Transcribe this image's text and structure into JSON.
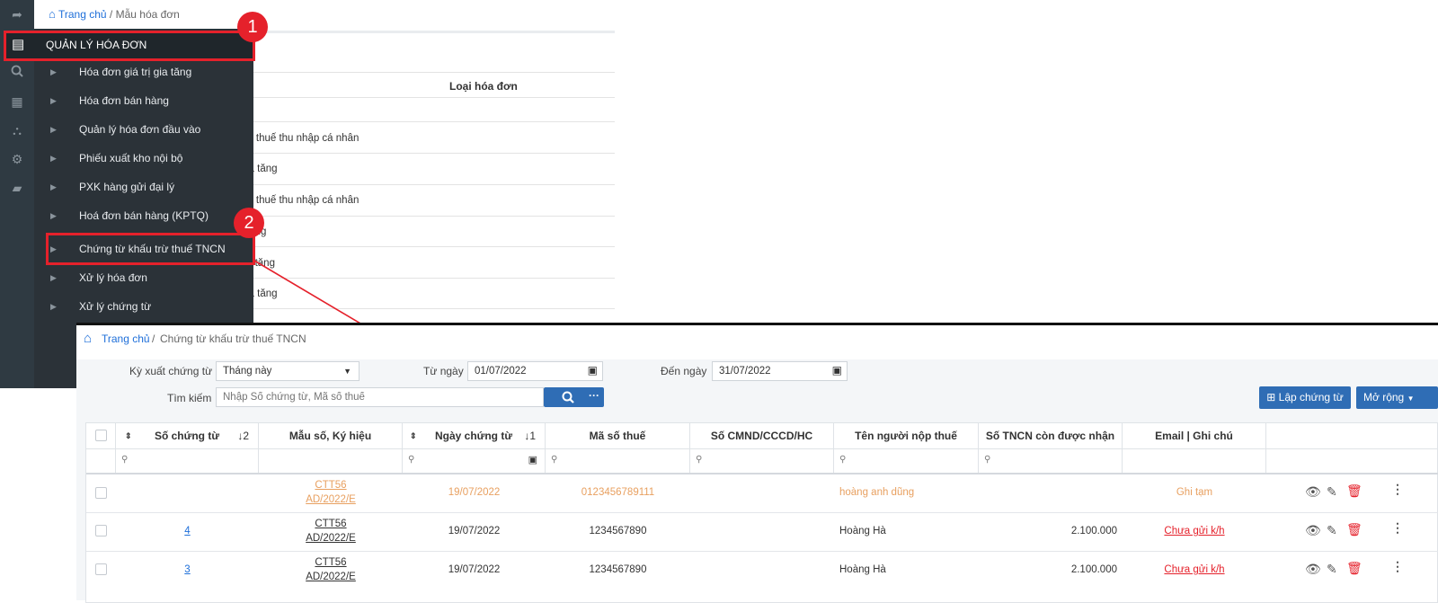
{
  "bg_page": {
    "breadcrumb_home": "Trang chủ",
    "breadcrumb_sep": "/",
    "breadcrumb_current": "Mẫu hóa đơn",
    "column_header": "Loại hóa đơn",
    "rows": [
      "ừ thuế thu nhập cá nhân",
      "ia tăng",
      "ừ thuế thu nhập cá nhân",
      "tăng",
      "a tăng",
      "ia tăng"
    ]
  },
  "menu": {
    "title": "QUẢN LÝ HÓA ĐƠN",
    "items": [
      "Hóa đơn giá trị gia tăng",
      "Hóa đơn bán hàng",
      "Quản lý hóa đơn đầu vào",
      "Phiếu xuất kho nội bộ",
      "PXK hàng gửi đại lý",
      "Hoá đơn bán hàng (KPTQ)",
      "Chứng từ khấu trừ thuế TNCN",
      "Xử lý hóa đơn",
      "Xử lý chứng từ"
    ]
  },
  "callouts": {
    "one": "1",
    "two": "2"
  },
  "colors": {
    "highlight": "#e5212b",
    "link": "#1e6fd9",
    "draft": "#e8a060",
    "unsent": "#e5212b",
    "primary": "#2f6db5"
  },
  "page": {
    "breadcrumb_home": "Trang chủ",
    "breadcrumb_sep": "/",
    "breadcrumb_current": "Chứng từ khấu trừ thuế TNCN",
    "filters": {
      "period_label": "Kỳ xuất chứng từ",
      "period_value": "Tháng này",
      "from_label": "Từ ngày",
      "from_value": "01/07/2022",
      "to_label": "Đến ngày",
      "to_value": "31/07/2022",
      "search_label": "Tìm kiếm",
      "search_placeholder": "Nhập Số chứng từ, Mã số thuế"
    },
    "buttons": {
      "create": "Lập chứng từ",
      "expand": "Mở rộng"
    },
    "table": {
      "headers": [
        "Số chứng từ",
        "Mẫu số, Ký hiệu",
        "Ngày chứng từ",
        "Mã số thuế",
        "Số CMND/CCCD/HC",
        "Tên người nộp thuế",
        "Số TNCN còn được nhận",
        "Email | Ghi chú"
      ],
      "sort_no_order": "2",
      "sort_date_order": "1",
      "rows": [
        {
          "no": "",
          "form_line1": "CTT56",
          "form_line2": "AD/2022/E",
          "date": "19/07/2022",
          "tax_code": "0123456789111",
          "id_no": "",
          "name": "hoàng anh dũng",
          "amount": "",
          "note": "Ghi tạm"
        },
        {
          "no": "4",
          "form_line1": "CTT56",
          "form_line2": "AD/2022/E",
          "date": "19/07/2022",
          "tax_code": "1234567890",
          "id_no": "",
          "name": "Hoàng Hà",
          "amount": "2.100.000",
          "note": "Chưa gửi k/h"
        },
        {
          "no": "3",
          "form_line1": "CTT56",
          "form_line2": "AD/2022/E",
          "date": "19/07/2022",
          "tax_code": "1234567890",
          "id_no": "",
          "name": "Hoàng Hà",
          "amount": "2.100.000",
          "note": "Chưa gửi k/h"
        }
      ]
    }
  }
}
